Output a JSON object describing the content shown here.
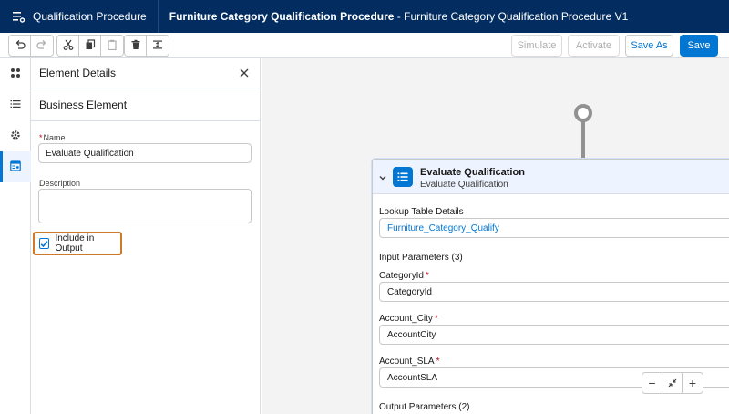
{
  "header": {
    "app_name": "Qualification Procedure",
    "title": "Furniture Category Qualification Procedure",
    "title_suffix": " - Furniture Category Qualification Procedure V1"
  },
  "toolbar": {
    "undo_icon": "undo-icon",
    "redo_icon": "redo-icon",
    "cut_icon": "cut-icon",
    "copy_icon": "copy-icon",
    "paste_icon": "paste-icon",
    "delete_icon": "delete-icon",
    "align_icon": "align-icon",
    "simulate_label": "Simulate",
    "activate_label": "Activate",
    "save_as_label": "Save As",
    "save_label": "Save"
  },
  "rail": {
    "items": [
      "elements-icon",
      "list-icon",
      "settings-icon",
      "details-icon"
    ],
    "active_index": 3
  },
  "panel": {
    "title": "Element Details",
    "section": "Business Element",
    "name_label": "Name",
    "name_value": "Evaluate Qualification",
    "description_label": "Description",
    "description_value": "",
    "include_output_label": "Include in Output",
    "include_output_checked": true
  },
  "card": {
    "title": "Evaluate Qualification",
    "subtitle": "Evaluate Qualification",
    "lookup_label": "Lookup Table Details",
    "lookup_value": "Furniture_Category_Qualify",
    "input_params_label": "Input Parameters (3)",
    "params": [
      {
        "label": "CategoryId",
        "value": "CategoryId"
      },
      {
        "label": "Account_City",
        "value": "AccountCity"
      },
      {
        "label": "Account_SLA",
        "value": "AccountSLA"
      }
    ],
    "output_params_label": "Output Parameters (2)"
  },
  "zoom": {
    "minus": "−",
    "plus": "+"
  },
  "colors": {
    "header_bg": "#032d60",
    "brand": "#0176d3",
    "highlight": "#cf7a2a",
    "required": "#ba0517"
  }
}
